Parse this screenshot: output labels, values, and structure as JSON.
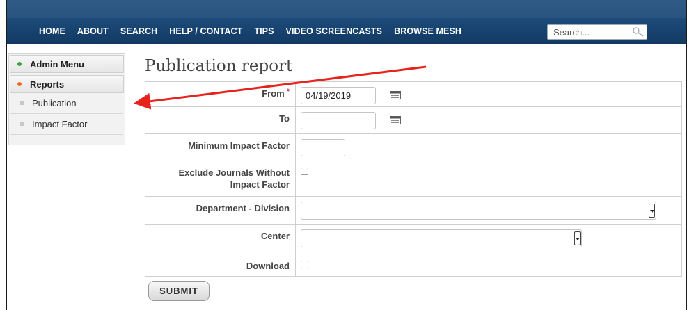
{
  "nav": {
    "items": [
      {
        "label": "HOME"
      },
      {
        "label": "ABOUT"
      },
      {
        "label": "SEARCH"
      },
      {
        "label": "HELP / CONTACT"
      },
      {
        "label": "TIPS"
      },
      {
        "label": "VIDEO SCREENCASTS"
      },
      {
        "label": "BROWSE MESH"
      }
    ],
    "search_placeholder": "Search...",
    "search_icon": "magnifier-icon"
  },
  "sidebar": {
    "admin_menu": {
      "label": "Admin Menu",
      "dot_color": "#3aa03a"
    },
    "reports": {
      "label": "Reports",
      "dot_color": "#ee6a1f"
    },
    "items": [
      {
        "label": "Publication"
      },
      {
        "label": "Impact Factor"
      }
    ]
  },
  "page": {
    "title": "Publication report"
  },
  "form": {
    "from": {
      "label": "From",
      "required_mark": "*",
      "value": "04/19/2019"
    },
    "to": {
      "label": "To",
      "value": ""
    },
    "min_impact": {
      "label": "Minimum Impact Factor",
      "value": ""
    },
    "exclude": {
      "label_line1": "Exclude Journals Without",
      "label_line2": "Impact Factor",
      "checked": false
    },
    "department": {
      "label": "Department - Division",
      "value": ""
    },
    "center": {
      "label": "Center",
      "value": ""
    },
    "download": {
      "label": "Download",
      "checked": false
    },
    "submit_label": "SUBMIT"
  },
  "annotation": {
    "arrow_color": "#e8231d"
  },
  "colors": {
    "nav_bg": "#1d4b7a",
    "required": "#c8102e"
  }
}
